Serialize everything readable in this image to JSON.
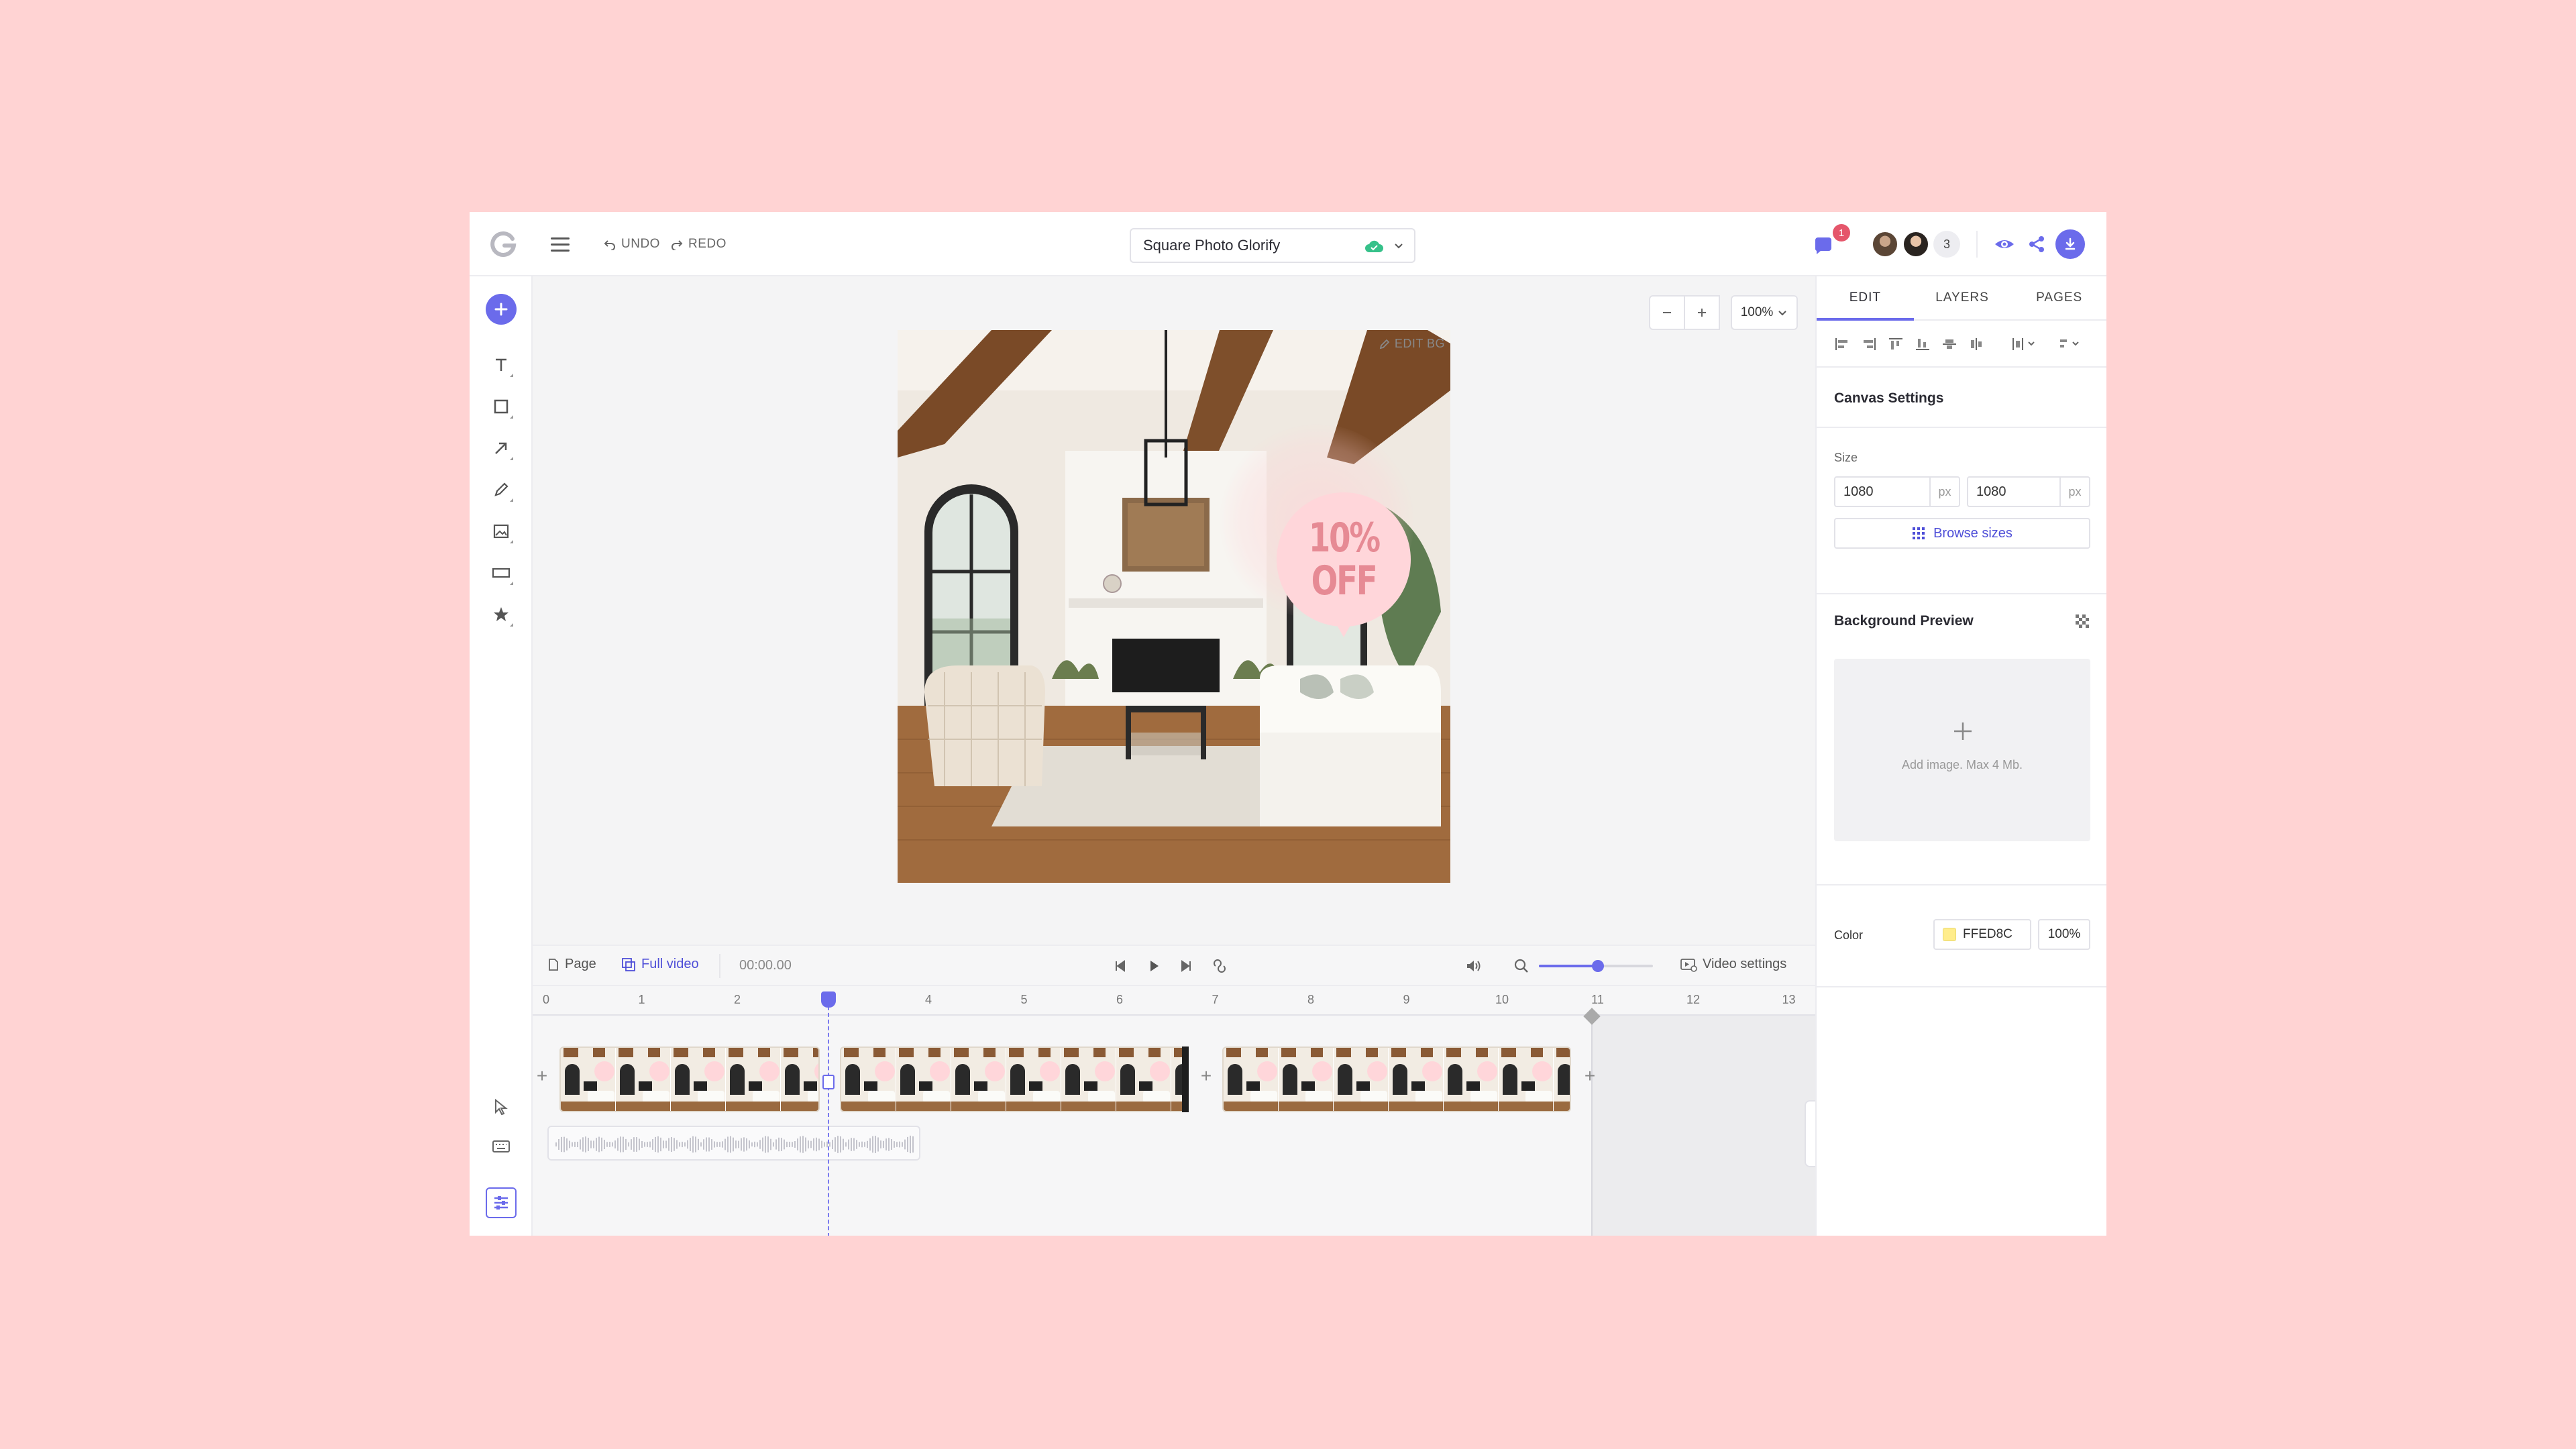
{
  "colors": {
    "background": "#FFD3D3",
    "accent": "#6B6BEB",
    "badge": "#E5566B",
    "sale_circle": "#FFD6DA",
    "sale_text": "#E68A94",
    "bg_color": "#FFED8C"
  },
  "header": {
    "undo_label": "UNDO",
    "redo_label": "REDO",
    "document_title": "Square Photo Glorify",
    "notification_count": "1",
    "collaborator_count": "3"
  },
  "canvas": {
    "zoom_label": "100%",
    "edit_bg_label": "EDIT BG",
    "sale_line1": "10%",
    "sale_line2": "OFF"
  },
  "timeline": {
    "page_label": "Page",
    "full_video_label": "Full video",
    "time": "00:00.00",
    "video_settings_label": "Video settings",
    "zoom_level": 0.52,
    "ticks": [
      "0",
      "1",
      "2",
      "3",
      "4",
      "5",
      "6",
      "7",
      "8",
      "9",
      "10",
      "11",
      "12",
      "13"
    ]
  },
  "panel": {
    "tabs": [
      "EDIT",
      "LAYERS",
      "PAGES"
    ],
    "active_tab": "EDIT",
    "canvas_settings_title": "Canvas Settings",
    "size_label": "Size",
    "width": "1080",
    "height": "1080",
    "unit": "px",
    "browse_sizes_label": "Browse sizes",
    "background_preview_title": "Background Preview",
    "add_image_hint": "Add image. Max 4 Mb.",
    "color_label": "Color",
    "color_hex": "FFED8C",
    "color_opacity": "100%"
  }
}
